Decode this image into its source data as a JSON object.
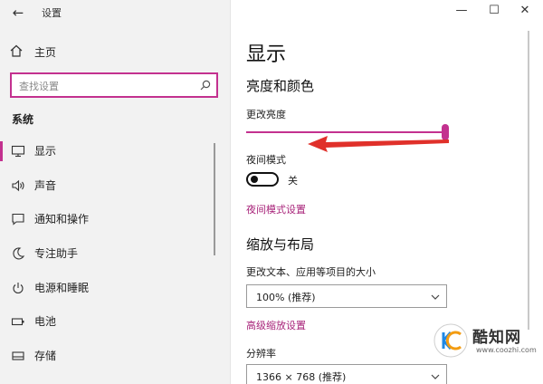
{
  "window": {
    "title": "设置",
    "controls": {
      "minimize": "—",
      "maximize": "☐",
      "close": "✕"
    }
  },
  "sidebar": {
    "home_label": "主页",
    "search_placeholder": "查找设置",
    "section_label": "系统",
    "items": [
      {
        "label": "显示",
        "icon": "monitor-icon",
        "selected": true
      },
      {
        "label": "声音",
        "icon": "speaker-icon",
        "selected": false
      },
      {
        "label": "通知和操作",
        "icon": "notification-icon",
        "selected": false
      },
      {
        "label": "专注助手",
        "icon": "moon-icon",
        "selected": false
      },
      {
        "label": "电源和睡眠",
        "icon": "power-icon",
        "selected": false
      },
      {
        "label": "电池",
        "icon": "battery-icon",
        "selected": false
      },
      {
        "label": "存储",
        "icon": "storage-icon",
        "selected": false
      }
    ]
  },
  "main": {
    "title": "显示",
    "brightness_section": "亮度和颜色",
    "brightness_label": "更改亮度",
    "brightness_value": 1.0,
    "night_mode_label": "夜间模式",
    "night_mode_state": "关",
    "night_mode_on": false,
    "night_mode_link": "夜间模式设置",
    "scale_section": "缩放与布局",
    "scale_label": "更改文本、应用等项目的大小",
    "scale_value": "100% (推荐)",
    "advanced_link": "高级缩放设置",
    "resolution_label": "分辨率",
    "resolution_value": "1366 × 768 (推荐)"
  },
  "watermark": {
    "name": "酷知网",
    "url": "www.coozhi.com"
  },
  "colors": {
    "accent": "#c3318f",
    "link": "#a8247a",
    "arrow": "#e0302a"
  }
}
